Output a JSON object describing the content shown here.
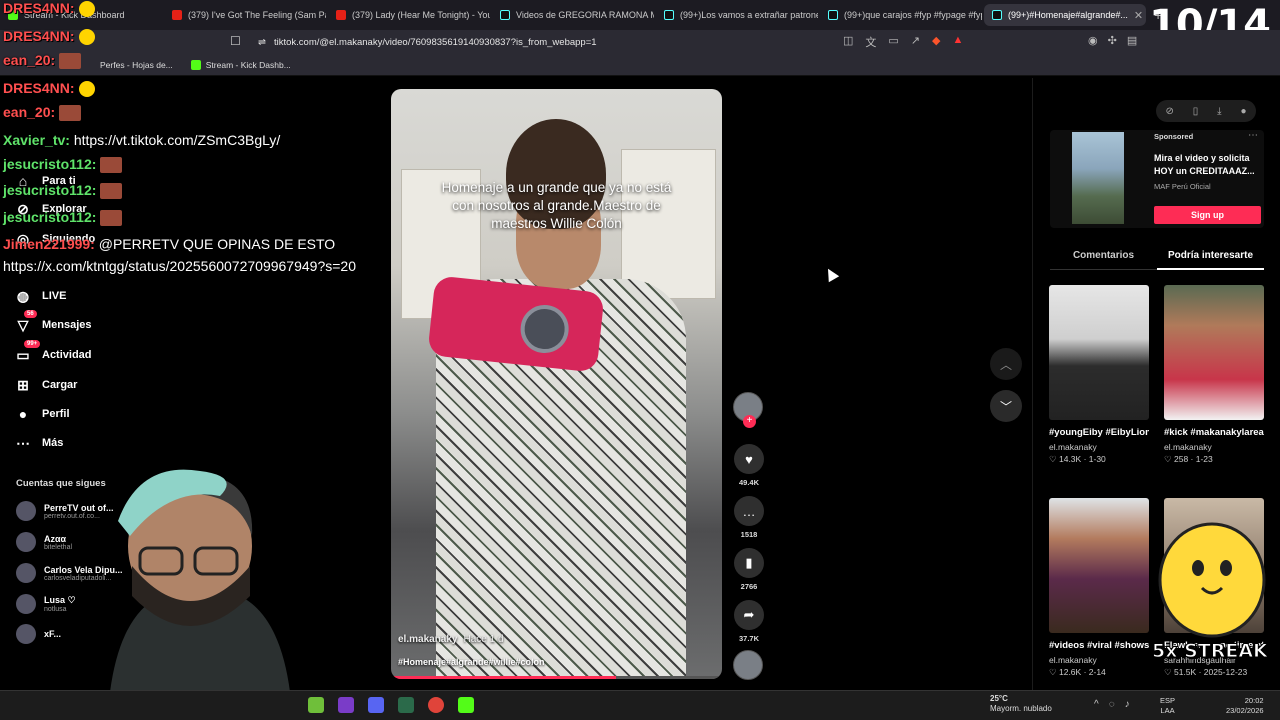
{
  "browser": {
    "tabs": [
      {
        "label": "Stream - Kick Dashboard",
        "icon": "kick-icon"
      },
      {
        "label": "(379) I've Got The Feeling (Sam Paran...",
        "icon": "youtube-icon"
      },
      {
        "label": "(379) Lady (Hear Me Tonight) - YouTu...",
        "icon": "youtube-icon"
      },
      {
        "label": "Videos de GREGORIA RAMONA MEJ...",
        "icon": "tiktok-icon"
      },
      {
        "label": "(99+)Los vamos a extrañar patrones...",
        "icon": "tiktok-icon"
      },
      {
        "label": "(99+)que carajos #fyp #fypage #fyp...",
        "icon": "tiktok-icon"
      },
      {
        "label": "(99+)#Homenaje#algrande#...",
        "icon": "tiktok-icon"
      }
    ],
    "url": "tiktok.com/@el.makanaky/video/7609835619140930837?is_from_webapp=1",
    "bookmarks": [
      {
        "label": "Perfes - Hojas de..."
      },
      {
        "label": "Stream - Kick Dashb..."
      }
    ]
  },
  "overlay": {
    "counter": "10/14",
    "streak": "5x STREAK"
  },
  "chat": [
    {
      "user": "DRES4NN:",
      "msg": "",
      "color": "red"
    },
    {
      "user": "DRES4NN:",
      "msg": "",
      "color": "red"
    },
    {
      "user": "ean_20:",
      "msg": "",
      "color": "red"
    },
    {
      "user": "DRES4NN:",
      "msg": "",
      "color": "red"
    },
    {
      "user": "ean_20:",
      "msg": "",
      "color": "red"
    },
    {
      "user": "Xavier_tv:",
      "msg": "https://vt.tiktok.com/ZSmC3BgLy/",
      "color": "green"
    },
    {
      "user": "jesucristo112:",
      "msg": "",
      "color": "green"
    },
    {
      "user": "jesucristo112:",
      "msg": "",
      "color": "green"
    },
    {
      "user": "jesucristo112:",
      "msg": "",
      "color": "green"
    },
    {
      "user": "Jimen221999:",
      "msg": "@PERRETV QUE OPINAS DE ESTO",
      "color": "red"
    },
    {
      "user": "",
      "msg": "https://x.com/ktntgg/status/2025560072709967949?s=20",
      "color": "green"
    }
  ],
  "sidebar": {
    "items": [
      {
        "label": "Para ti",
        "icon": "home-icon"
      },
      {
        "label": "Explorar",
        "icon": "compass-icon"
      },
      {
        "label": "Siguiendo",
        "icon": "following-icon"
      },
      {
        "label": "LIVE",
        "icon": "live-icon"
      },
      {
        "label": "Mensajes",
        "icon": "message-icon",
        "badge": "56"
      },
      {
        "label": "Actividad",
        "icon": "activity-icon",
        "badge": "99+"
      },
      {
        "label": "Cargar",
        "icon": "upload-icon"
      },
      {
        "label": "Perfil",
        "icon": "profile-icon"
      },
      {
        "label": "Más",
        "icon": "more-icon"
      }
    ],
    "following_title": "Cuentas que sigues",
    "following": [
      {
        "name": "PerreTV out of...",
        "handle": "perretv.out.of.co..."
      },
      {
        "name": "Azαα",
        "handle": "bitelethal"
      },
      {
        "name": "Carlos Vela Dipu...",
        "handle": "carlosveladiputadoli..."
      },
      {
        "name": "Lusa ♡",
        "handle": "notlusa"
      },
      {
        "name": "xF...",
        "handle": ""
      }
    ]
  },
  "video": {
    "caption": "Homenaje a un grande que ya no está con nosotros al grande.Maestro de maestros Willie Colón",
    "author": "el.makanaky",
    "time": "Hace 1 d",
    "tags": "#Homenaje#algrande#willie#colon",
    "progress": 0.68
  },
  "actions": [
    {
      "icon": "heart-icon",
      "count": "49.4K"
    },
    {
      "icon": "comment-icon",
      "count": "1518"
    },
    {
      "icon": "bookmark-icon",
      "count": "2766"
    },
    {
      "icon": "share-icon",
      "count": "37.7K"
    }
  ],
  "right": {
    "ad": {
      "sponsored": "Sponsored",
      "text": "Mira el video y solicita HOY un CREDITAAAZ...",
      "brand": "MAF Perú Oficial",
      "button": "Sign up"
    },
    "tabs": [
      "Comentarios",
      "Podría interesarte"
    ],
    "cards": [
      {
        "title": "#youngEiby #EibyLion #viral...",
        "author": "el.makanaky",
        "likes": "14.3K",
        "date": "1-30"
      },
      {
        "title": "#kick #makanakylareal...",
        "author": "el.makanaky",
        "likes": "258",
        "date": "1-23"
      },
      {
        "title": "#videos #viral #shows #gaaaaa...",
        "author": "el.makanaky",
        "likes": "12.6K",
        "date": "2-14"
      },
      {
        "title": "Flawless... one time at the...",
        "author": "sarahhindsgaulhair",
        "likes": "51.5K",
        "date": "2025-12-23"
      }
    ]
  },
  "taskbar": {
    "weather_temp": "25°C",
    "weather_desc": "Mayorm. nublado",
    "lang1": "ESP",
    "lang2": "LAA",
    "time": "20:02",
    "date": "23/02/2026"
  }
}
